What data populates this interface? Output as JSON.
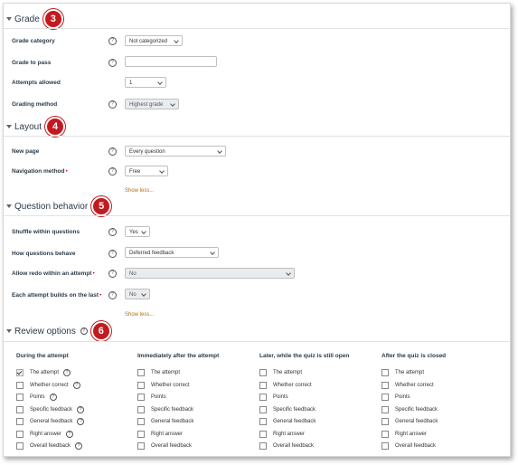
{
  "sections": {
    "grade": {
      "title": "Grade",
      "badge": "3"
    },
    "layout": {
      "title": "Layout",
      "badge": "4"
    },
    "behavior": {
      "title": "Question behavior",
      "badge": "5"
    },
    "review": {
      "title": "Review options",
      "badge": "6"
    }
  },
  "grade": {
    "category_label": "Grade category",
    "category_value": "Not categorized",
    "pass_label": "Grade to pass",
    "pass_value": "",
    "attempts_label": "Attempts allowed",
    "attempts_value": "1",
    "method_label": "Grading method",
    "method_value": "Highest grade"
  },
  "layout": {
    "newpage_label": "New page",
    "newpage_value": "Every question",
    "nav_label": "Navigation method",
    "nav_value": "Free",
    "show_less": "Show less..."
  },
  "behavior": {
    "shuffle_label": "Shuffle within questions",
    "shuffle_value": "Yes",
    "how_label": "How questions behave",
    "how_value": "Deferred feedback",
    "redo_label": "Allow redo within an attempt",
    "redo_value": "No",
    "builds_label": "Each attempt builds on the last",
    "builds_value": "No",
    "show_less": "Show less..."
  },
  "help_glyph": "?",
  "review": {
    "columns": [
      {
        "heading": "During the attempt"
      },
      {
        "heading": "Immediately after the attempt"
      },
      {
        "heading": "Later, while the quiz is still open"
      },
      {
        "heading": "After the quiz is closed"
      }
    ],
    "options": [
      "The attempt",
      "Whether correct",
      "Points",
      "Specific feedback",
      "General feedback",
      "Right answer",
      "Overall feedback"
    ]
  }
}
